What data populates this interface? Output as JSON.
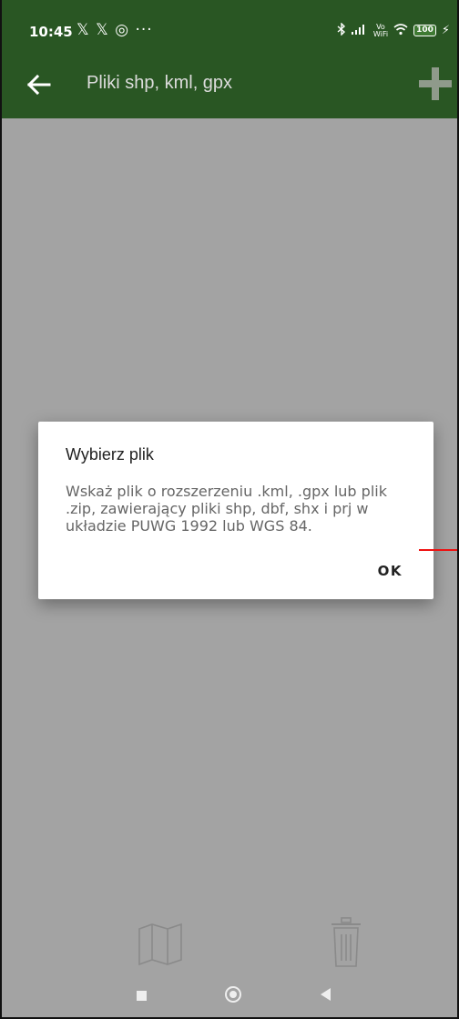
{
  "status_bar": {
    "time": "10:45",
    "left_icons": "𝕏 𝕏 ◎ ···",
    "signal_text": "\u0000",
    "wifi_calling": "Vo WiFi",
    "battery": "100"
  },
  "toolbar": {
    "title": "Pliki shp, kml, gpx",
    "back_icon": "arrow-left-icon",
    "add_icon": "plus-icon"
  },
  "dialog": {
    "title": "Wybierz plik",
    "message": "Wskaż plik o rozszerzeniu .kml, .gpx lub plik .zip, zawierający pliki shp, dbf, shx i prj w układzie PUWG 1992 lub WGS 84.",
    "ok_label": "OK"
  },
  "bottom_actions": {
    "map_icon": "map-icon",
    "trash_icon": "trash-icon"
  },
  "nav": {
    "recents_icon": "square-icon",
    "home_icon": "circle-icon",
    "back_icon": "triangle-back-icon"
  },
  "colors": {
    "toolbar_bg": "#295623",
    "scrim_bg": "#a3a3a3",
    "dialog_bg": "#ffffff",
    "accent_line": "#e11111"
  }
}
